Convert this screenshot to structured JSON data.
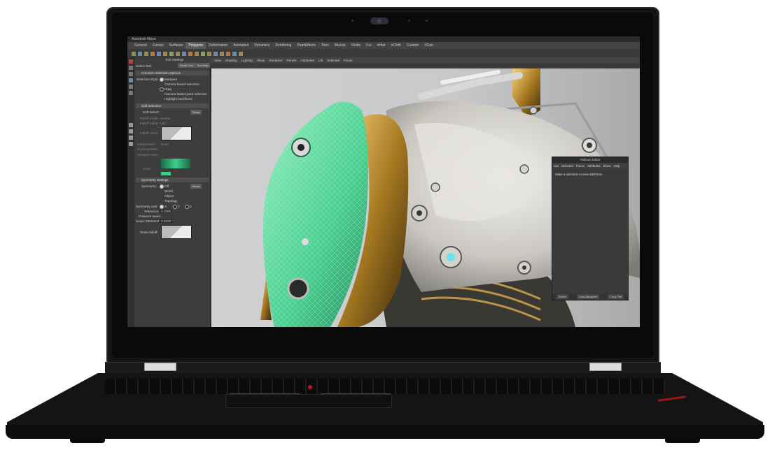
{
  "app": {
    "title_bar": "Autodesk Maya",
    "shelf_tabs": [
      "General",
      "Curves",
      "Surfaces",
      "Polygons",
      "Deformation",
      "Animation",
      "Dynamics",
      "Rendering",
      "PaintEffects",
      "Toon",
      "Muscle",
      "Fluids",
      "Fur",
      "nHair",
      "nCloth",
      "Custom",
      "XGen"
    ],
    "active_shelf_tab": "Polygons"
  },
  "tool_settings": {
    "title": "Tool Settings",
    "tool_name": "Select Tool",
    "reset_button": "Reset Tool",
    "help_button": "Tool Help",
    "common_header": "Common Selection Options",
    "selection_style_label": "Selection Style:",
    "selection_style_options": [
      "Marquee",
      "Camera based selection",
      "Drag",
      "Camera based paint selection"
    ],
    "highlight_backfaces": "Highlight backfaces",
    "soft_header": "Soft Selection",
    "soft_select_label": "Soft Select:",
    "reset_label": "Reset",
    "falloff_mode_label": "Falloff mode:",
    "falloff_mode_value": "Volume",
    "falloff_radius_label": "Falloff radius:",
    "falloff_radius_value": "5.00",
    "falloff_curve_label": "Falloff curve:",
    "interpolation_label": "Interpolation:",
    "interpolation_value": "None",
    "curve_presets_label": "Curve presets:",
    "viewport_color_label": "Viewport color:",
    "color_label": "Color:",
    "symmetry_header": "Symmetry Settings",
    "symmetry_label": "Symmetry:",
    "symmetry_options": [
      "Off",
      "World",
      "Object",
      "Topology"
    ],
    "symmetry_axis_label": "Symmetry axis:",
    "axis_options": [
      "X",
      "Y",
      "Z"
    ],
    "tolerance_label": "Tolerance:",
    "tolerance_value": "0.1000",
    "preserve_seam_label": "Preserve seam:",
    "seam_tolerance_label": "Seam Tolerance:",
    "seam_tolerance_value": "0.0100",
    "seam_falloff_label": "Seam falloff:"
  },
  "viewport_menu": [
    "View",
    "Shading",
    "Lighting",
    "Show",
    "Renderer",
    "Panels",
    "Attributes",
    "Lift",
    "Selected",
    "Focus"
  ],
  "attribute_editor": {
    "title": "Attribute Editor",
    "menu": [
      "List",
      "Selected",
      "Focus",
      "Attributes",
      "Show",
      "Help"
    ],
    "message": "Make a selection to view attributes.",
    "buttons": [
      "Select",
      "Load Attributes",
      "Copy Tab"
    ]
  },
  "colors": {
    "viewport_bg": "#c9cbcc",
    "selection_green": "#3ecf8a",
    "accent_red": "#c01818"
  },
  "brand": "ThinkPad"
}
